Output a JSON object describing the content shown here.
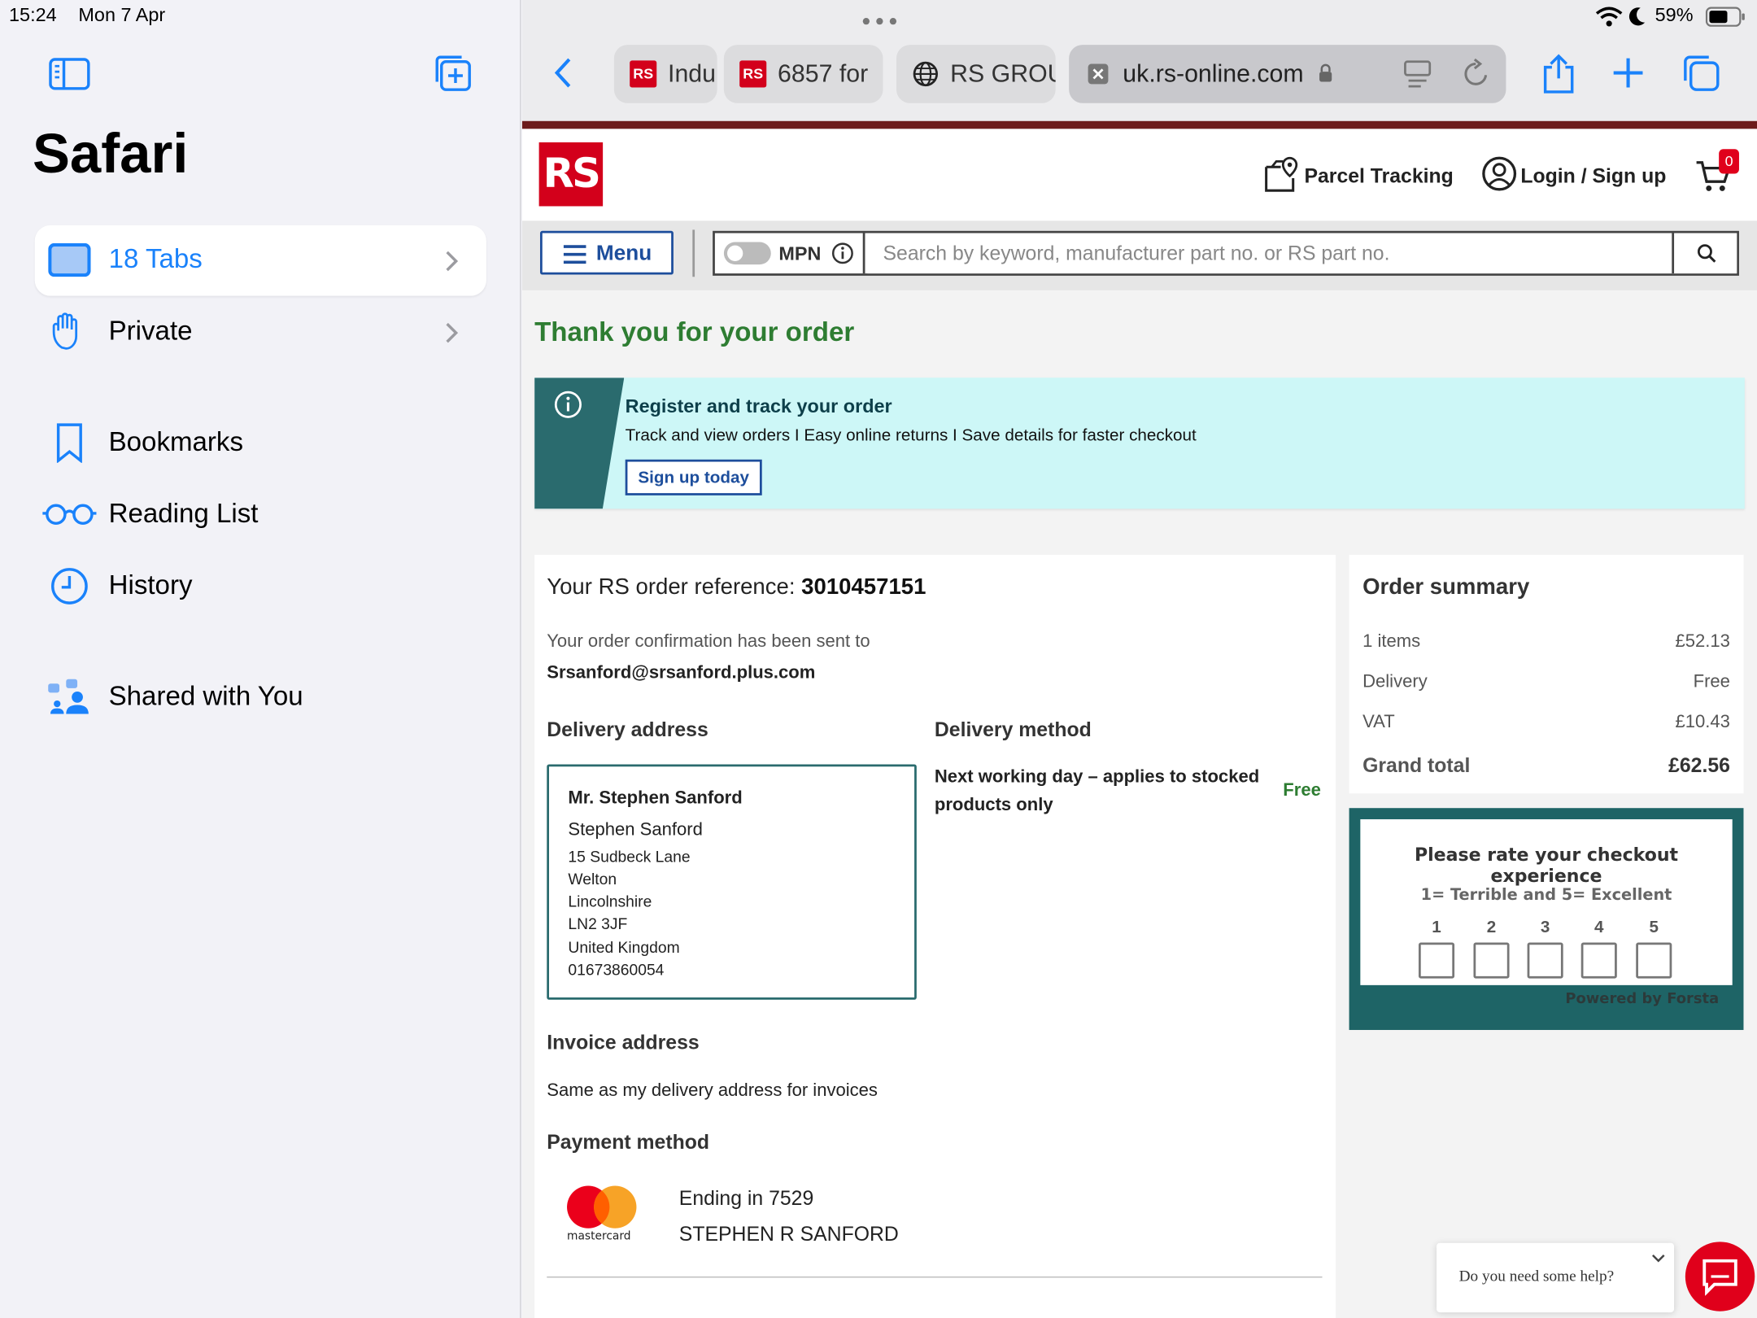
{
  "status_bar": {
    "time": "15:24",
    "date": "Mon 7 Apr",
    "battery": "59%"
  },
  "sidebar": {
    "title": "Safari",
    "tabs_label": "18 Tabs",
    "private_label": "Private",
    "bookmarks_label": "Bookmarks",
    "reading_list_label": "Reading List",
    "history_label": "History",
    "shared_label": "Shared with You"
  },
  "browser": {
    "tabs": [
      {
        "title": "Indu"
      },
      {
        "title": "6857 for"
      },
      {
        "title": "RS GROU"
      }
    ],
    "url": "uk.rs-online.com"
  },
  "site": {
    "logo_text": "RS",
    "parcel_tracking": "Parcel Tracking",
    "login_label": "Login / Sign up",
    "cart_count": "0",
    "menu_label": "Menu",
    "mpn_label": "MPN",
    "search_placeholder": "Search by keyword, manufacturer part no. or RS part no."
  },
  "order": {
    "thanks_title": "Thank you for your order",
    "banner_title": "Register and track your order",
    "banner_text": "Track and view orders I Easy online returns I Save details for faster checkout",
    "banner_button": "Sign up today",
    "ref_label": "Your RS order reference:",
    "ref_value": "3010457151",
    "confirm_text": "Your order confirmation has been sent to",
    "email": "Srsanford@srsanford.plus.com",
    "delivery_address_heading": "Delivery address",
    "address": {
      "name_bold": "Mr. Stephen Sanford",
      "name": "Stephen Sanford",
      "line1": "15 Sudbeck Lane",
      "line2": "Welton",
      "line3": "Lincolnshire",
      "postcode": "LN2 3JF",
      "country": "United Kingdom",
      "phone": "01673860054"
    },
    "delivery_method_heading": "Delivery method",
    "delivery_method_line1": "Next working day – applies to stocked",
    "delivery_method_line2": "products only",
    "delivery_method_price": "Free",
    "invoice_heading": "Invoice address",
    "invoice_text": "Same as my delivery address for invoices",
    "payment_heading": "Payment method",
    "card_brand": "mastercard",
    "card_ending": "Ending in 7529",
    "card_holder": "STEPHEN R SANFORD"
  },
  "summary": {
    "heading": "Order summary",
    "items_label": "1 items",
    "items_value": "£52.13",
    "delivery_label": "Delivery",
    "delivery_value": "Free",
    "vat_label": "VAT",
    "vat_value": "£10.43",
    "total_label": "Grand total",
    "total_value": "£62.56"
  },
  "rating": {
    "title": "Please rate your checkout experience",
    "scale": "1= Terrible and 5= Excellent",
    "options": [
      "1",
      "2",
      "3",
      "4",
      "5"
    ],
    "powered": "Powered by Forsta"
  },
  "help": {
    "text": "Do you need some help?"
  },
  "colors": {
    "rs_red": "#d3001b",
    "rs_blue": "#1d4e9c",
    "teal": "#2a6b6e",
    "green": "#2e7d32",
    "ios_blue": "#1a82fb"
  }
}
